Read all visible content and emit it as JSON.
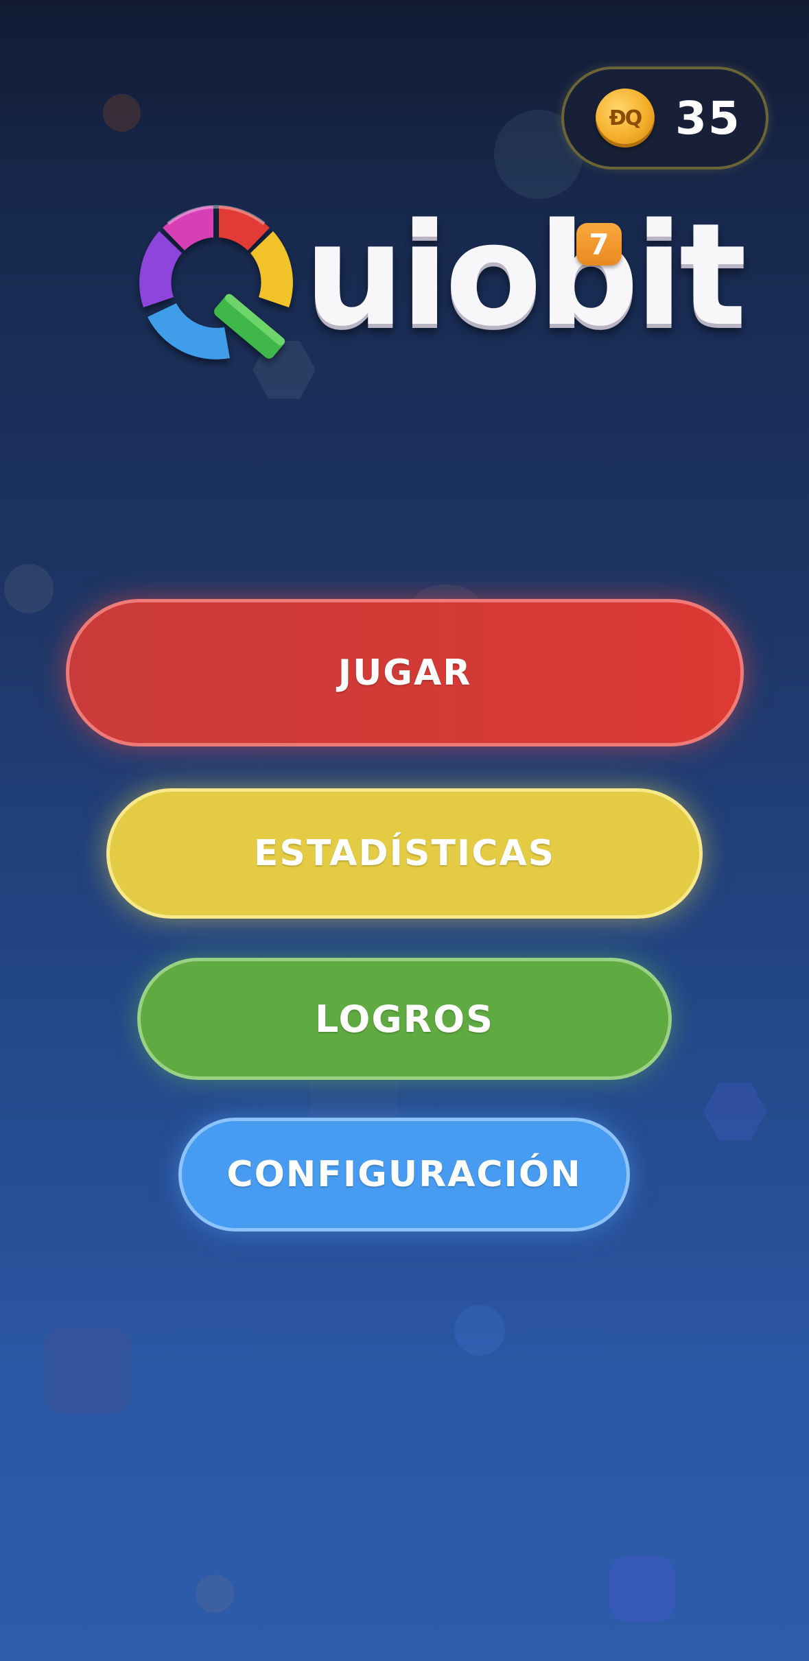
{
  "coins": {
    "icon_label": "ÐQ",
    "count": "35"
  },
  "logo": {
    "icon": "q-ring-logo",
    "wordmark": "uiobit",
    "badge": "7"
  },
  "menu": {
    "play_label": "JUGAR",
    "stats_label": "ESTADÍSTICAS",
    "achievements_label": "LOGROS",
    "settings_label": "CONFIGURACIÓN"
  },
  "colors": {
    "play": "#dc3a32",
    "stats": "#e3cb43",
    "achievements": "#60aa42",
    "settings": "#479bf0",
    "badge": "#f39a2f",
    "coin": "#f4ae29"
  }
}
